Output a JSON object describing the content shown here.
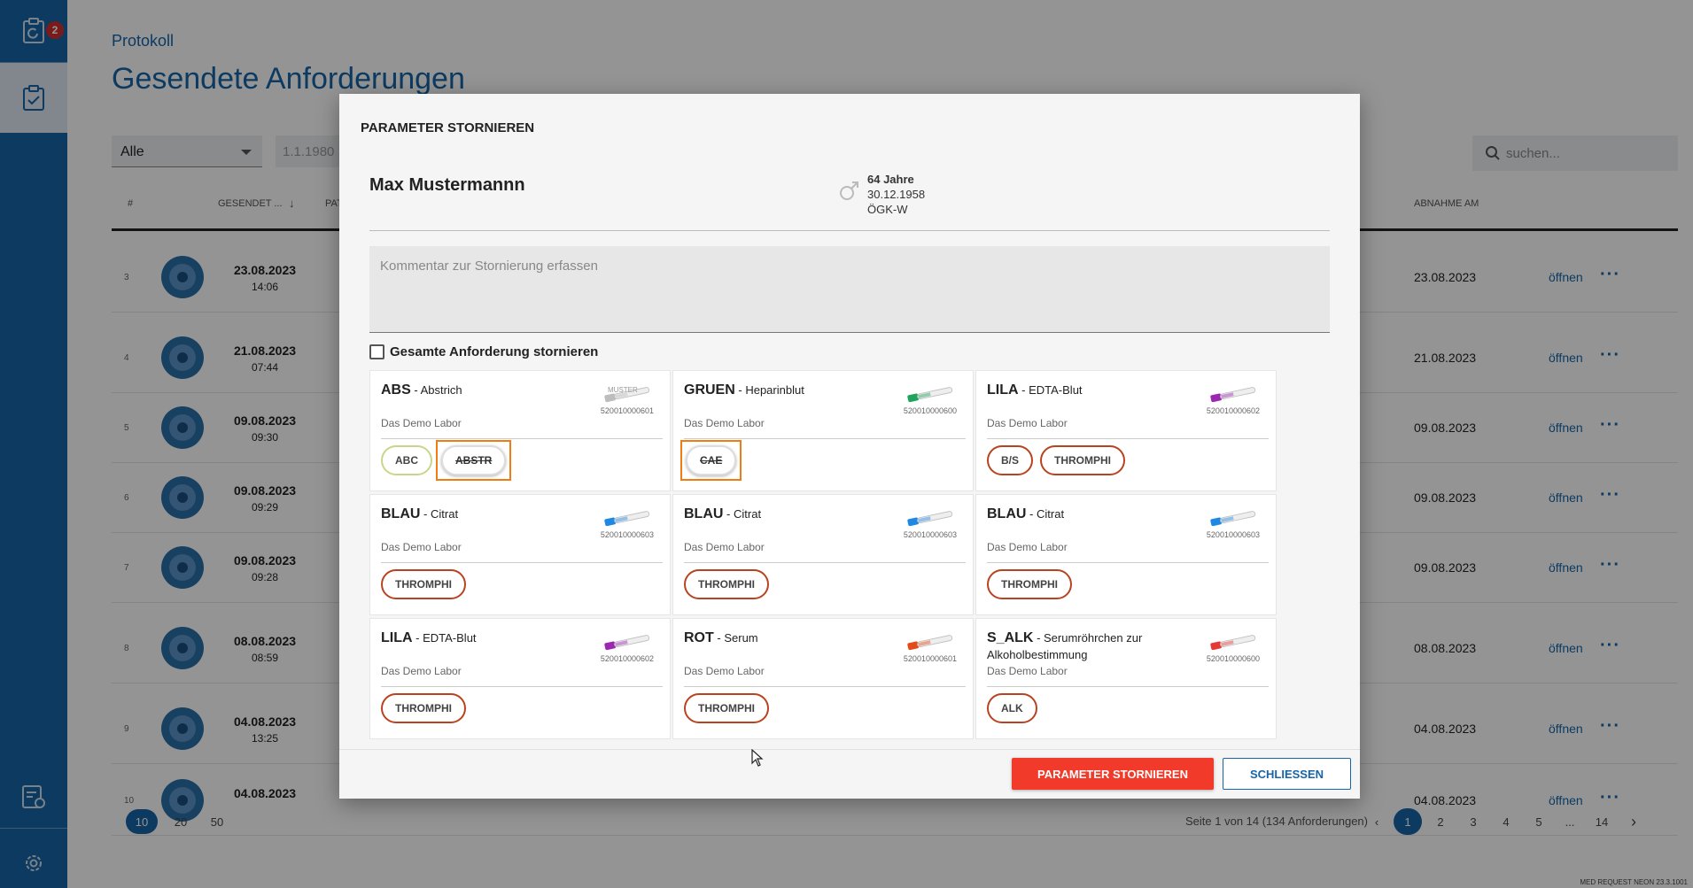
{
  "sidebar": {
    "badge_count": "2",
    "icons": [
      "clipboard-refresh-icon",
      "clipboard-check-icon",
      "document-settings-icon",
      "gear-icon"
    ]
  },
  "page": {
    "breadcrumb": "Protokoll",
    "title": "Gesendete Anforderungen",
    "filter_value": "Alle",
    "date_value": "1.1.1980",
    "search_placeholder": "suchen...",
    "columns": {
      "num": "#",
      "sent": "GESENDET ...",
      "pat": "PAT",
      "abnahme": "ABNAHME AM"
    },
    "rows": [
      {
        "num": "3",
        "date": "23.08.2023",
        "time": "14:06",
        "abnahme": "23.08.2023",
        "open": "öffnen"
      },
      {
        "num": "4",
        "date": "21.08.2023",
        "time": "07:44",
        "abnahme": "21.08.2023",
        "open": "öffnen"
      },
      {
        "num": "5",
        "date": "09.08.2023",
        "time": "09:30",
        "abnahme": "09.08.2023",
        "open": "öffnen"
      },
      {
        "num": "6",
        "date": "09.08.2023",
        "time": "09:29",
        "abnahme": "09.08.2023",
        "open": "öffnen"
      },
      {
        "num": "7",
        "date": "09.08.2023",
        "time": "09:28",
        "abnahme": "09.08.2023",
        "open": "öffnen"
      },
      {
        "num": "8",
        "date": "08.08.2023",
        "time": "08:59",
        "abnahme": "08.08.2023",
        "open": "öffnen"
      },
      {
        "num": "9",
        "date": "04.08.2023",
        "time": "13:25",
        "abnahme": "04.08.2023",
        "open": "öffnen"
      },
      {
        "num": "10",
        "date": "04.08.2023",
        "time": "",
        "abnahme": "04.08.2023",
        "open": "öffnen"
      }
    ],
    "page_sizes": [
      "10",
      "20",
      "50"
    ],
    "page_info": "Seite 1 von 14 (134 Anforderungen)",
    "pages": [
      "1",
      "2",
      "3",
      "4",
      "5",
      "...",
      "14"
    ],
    "version": "MED REQUEST NEON 23.3.1001"
  },
  "modal": {
    "title": "PARAMETER STORNIEREN",
    "patient": {
      "name": "Max Mustermannn",
      "age": "64 Jahre",
      "birthdate": "30.12.1958",
      "insurance": "ÖGK-W"
    },
    "comment_placeholder": "Kommentar zur Stornierung erfassen",
    "cancel_all_label": "Gesamte Anforderung stornieren",
    "cards": [
      {
        "code": "ABS",
        "desc": " - Abstrich",
        "lab": "Das Demo Labor",
        "barcode": "520010000601",
        "tube_color": "#bdbdbd",
        "tube_label": "MUSTER",
        "params": [
          {
            "label": "ABC",
            "style": "green"
          },
          {
            "label": "ABSTR",
            "style": "strike"
          }
        ]
      },
      {
        "code": "GRUEN",
        "desc": " - Heparinblut",
        "lab": "Das Demo Labor",
        "barcode": "520010000600",
        "tube_color": "#1fa45c",
        "tube_label": "",
        "params": [
          {
            "label": "CAE",
            "style": "strike"
          }
        ]
      },
      {
        "code": "LILA",
        "desc": " - EDTA-Blut",
        "lab": "Das Demo Labor",
        "barcode": "520010000602",
        "tube_color": "#9c27b0",
        "tube_label": "",
        "params": [
          {
            "label": "B/S",
            "style": "normal"
          },
          {
            "label": "THROMPHI",
            "style": "normal"
          }
        ]
      },
      {
        "code": "BLAU",
        "desc": " - Citrat",
        "lab": "Das Demo Labor",
        "barcode": "520010000603",
        "tube_color": "#1e88e5",
        "tube_label": "",
        "params": [
          {
            "label": "THROMPHI",
            "style": "normal"
          }
        ]
      },
      {
        "code": "BLAU",
        "desc": " - Citrat",
        "lab": "Das Demo Labor",
        "barcode": "520010000603",
        "tube_color": "#1e88e5",
        "tube_label": "",
        "params": [
          {
            "label": "THROMPHI",
            "style": "normal"
          }
        ]
      },
      {
        "code": "BLAU",
        "desc": " - Citrat",
        "lab": "Das Demo Labor",
        "barcode": "520010000603",
        "tube_color": "#1e88e5",
        "tube_label": "",
        "params": [
          {
            "label": "THROMPHI",
            "style": "normal"
          }
        ]
      },
      {
        "code": "LILA",
        "desc": " - EDTA-Blut",
        "lab": "Das Demo Labor",
        "barcode": "520010000602",
        "tube_color": "#9c27b0",
        "tube_label": "",
        "params": [
          {
            "label": "THROMPHI",
            "style": "normal"
          }
        ]
      },
      {
        "code": "ROT",
        "desc": " - Serum",
        "lab": "Das Demo Labor",
        "barcode": "520010000601",
        "tube_color": "#e64a19",
        "tube_label": "",
        "params": [
          {
            "label": "THROMPHI",
            "style": "normal"
          }
        ]
      },
      {
        "code": "S_ALK",
        "desc": " - Serumröhrchen zur Alkoholbestimmung",
        "lab": "Das Demo Labor",
        "barcode": "520010000600",
        "tube_color": "#e53935",
        "tube_label": "",
        "params": [
          {
            "label": "ALK",
            "style": "normal"
          }
        ]
      }
    ],
    "cancel_button": "PARAMETER STORNIEREN",
    "close_button": "SCHLIESSEN"
  }
}
